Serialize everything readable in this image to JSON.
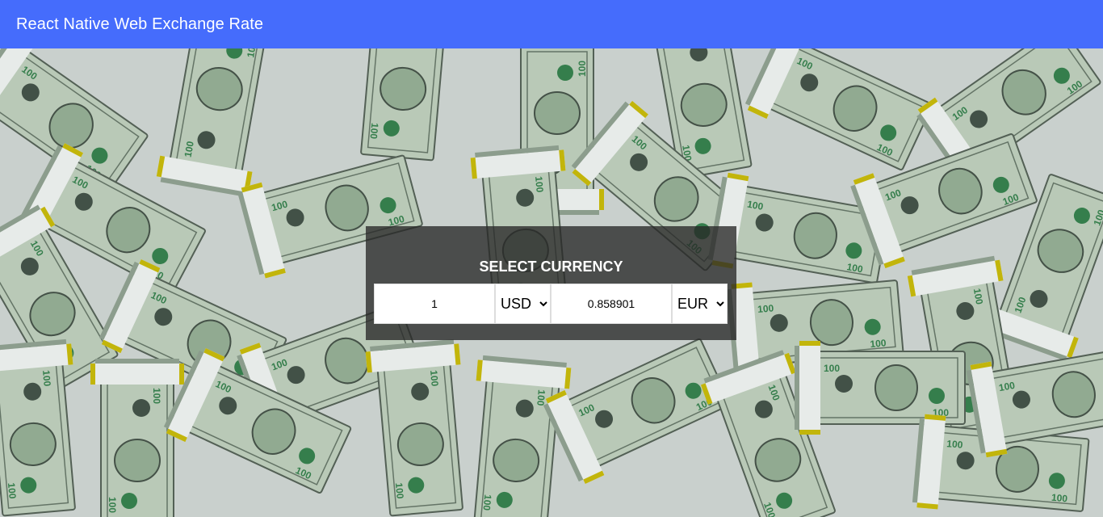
{
  "header": {
    "title": "React Native Web Exchange Rate",
    "background_color": "#456cfc"
  },
  "background": {
    "description_icon": "money-bills-background"
  },
  "converter": {
    "title": "SELECT CURRENCY",
    "from_amount": "1",
    "from_currency": "USD",
    "to_amount": "0.858901",
    "to_currency": "EUR"
  }
}
